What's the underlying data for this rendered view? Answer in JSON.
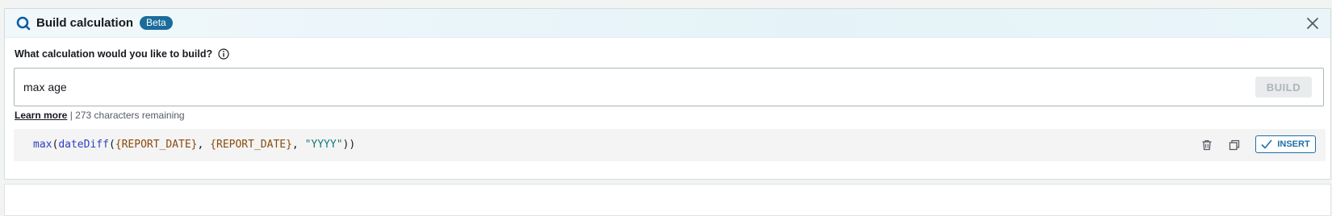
{
  "header": {
    "title": "Build calculation",
    "badge": "Beta",
    "icon": "q-search-icon",
    "close_icon": "close-icon"
  },
  "prompt": {
    "question": "What calculation would you like to build?",
    "info_icon": "info-icon",
    "input_value": "max age",
    "build_label": "BUILD",
    "learn_more": "Learn more",
    "separator": "|",
    "remaining": "273 characters remaining"
  },
  "result": {
    "tokens": [
      {
        "t": "max",
        "k": "fn"
      },
      {
        "t": "(",
        "k": "pn"
      },
      {
        "t": "dateDiff",
        "k": "fn"
      },
      {
        "t": "(",
        "k": "pn"
      },
      {
        "t": "{REPORT_DATE}",
        "k": "field"
      },
      {
        "t": ", ",
        "k": "pn"
      },
      {
        "t": "{REPORT_DATE}",
        "k": "field"
      },
      {
        "t": ", ",
        "k": "pn"
      },
      {
        "t": "\"YYYY\"",
        "k": "str"
      },
      {
        "t": "))",
        "k": "pn"
      }
    ],
    "insert_label": "INSERT",
    "delete_icon": "trash-icon",
    "copy_icon": "copy-icon",
    "check_icon": "check-icon"
  },
  "colors": {
    "accent": "#1d6fa5",
    "badge": "#1a6c9b",
    "function": "#2d3fc2",
    "field": "#8a4a0b",
    "string": "#127a7a"
  }
}
